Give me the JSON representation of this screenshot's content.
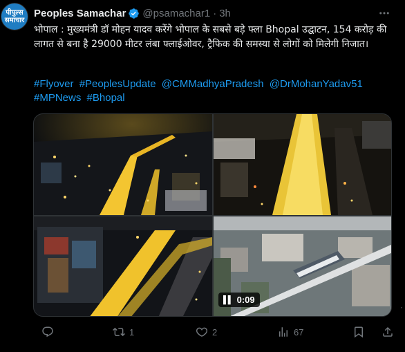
{
  "account": {
    "name": "Peoples Samachar",
    "handle": "@psamachar1",
    "separator": "·",
    "time": "3h",
    "avatar_line1": "पीपुल्स",
    "avatar_line2": "समाचार",
    "avatar_color": "#1f7dc2"
  },
  "tweet": {
    "text": "भोपाल : मुख्यमंत्री डॉ मोहन यादव करेंगे भोपाल के सबसे बड़े फ्ला Bhopal उद्घाटन, 154 करोड़ की लागत से बना है 29000 मीटर लंबा फ्लाईओवर, ट्रैफिक की समस्या से लोगों को मिलेगी निजात।",
    "hashtags": [
      "#Flyover",
      "#PeoplesUpdate",
      "@CMMadhyaPradesh",
      "@DrMohanYadav51",
      "#MPNews",
      "#Bhopal"
    ]
  },
  "media": {
    "video_duration": "0:09",
    "images": [
      "night-aerial-city-flyover",
      "night-flyover-road-closeup",
      "night-flyover-mall",
      "day-aerial-flyover-city"
    ]
  },
  "actions": {
    "reply_count": "",
    "retweet_count": "1",
    "like_count": "2",
    "views_count": "67"
  },
  "icons": [
    "verified-badge-icon",
    "more-icon",
    "pause-icon",
    "reply-icon",
    "retweet-icon",
    "like-icon",
    "views-icon",
    "bookmark-icon",
    "share-icon"
  ],
  "colors": {
    "background": "#000000",
    "text": "#e7e9ea",
    "secondary": "#71767b",
    "link": "#1d9bf0",
    "verified": "#1d9bf0"
  }
}
